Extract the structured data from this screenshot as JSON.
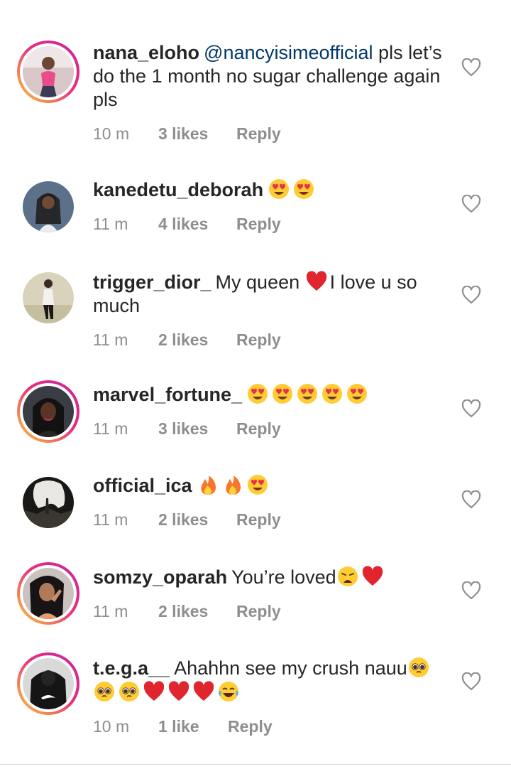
{
  "comments": [
    {
      "username": "nana_eloho",
      "mention": "@nancyisimeofficial",
      "text": " pls let’s do the 1 month no sugar challenge again pls",
      "time": "10 m",
      "likes": "3 likes",
      "reply": "Reply",
      "emojis": [],
      "emoji_text": ""
    },
    {
      "username": "kanedetu_deborah",
      "mention": "",
      "text": "",
      "time": "11 m",
      "likes": "4 likes",
      "reply": "Reply",
      "emojis": [
        "heart-eyes",
        "heart-eyes"
      ],
      "emoji_text": ""
    },
    {
      "username": "trigger_dior_",
      "mention": "",
      "text": "My queen ",
      "time": "11 m",
      "likes": "2 likes",
      "reply": "Reply",
      "emojis": [
        "red-heart"
      ],
      "emoji_text": "I love u so much"
    },
    {
      "username": "marvel_fortune_",
      "mention": "",
      "text": "",
      "time": "11 m",
      "likes": "3 likes",
      "reply": "Reply",
      "emojis": [
        "heart-eyes",
        "heart-eyes",
        "heart-eyes",
        "heart-eyes",
        "heart-eyes"
      ],
      "emoji_text": ""
    },
    {
      "username": "official_ica",
      "mention": "",
      "text": "",
      "time": "11 m",
      "likes": "2 likes",
      "reply": "Reply",
      "emojis": [
        "fire",
        "fire",
        "heart-eyes"
      ],
      "emoji_text": ""
    },
    {
      "username": "somzy_oparah",
      "mention": "",
      "text": "You’re loved",
      "time": "11 m",
      "likes": "2 likes",
      "reply": "Reply",
      "emojis": [
        "weary-face",
        "red-heart"
      ],
      "emoji_text": ""
    },
    {
      "username": "t.e.g.a__",
      "mention": "",
      "text": "Ahahhn see my crush nauu",
      "time": "10 m",
      "likes": "1 like",
      "reply": "Reply",
      "emojis": [
        "pleading-face",
        "pleading-face",
        "pleading-face",
        "red-heart",
        "red-heart",
        "red-heart",
        "tears-of-joy"
      ],
      "emoji_text": ""
    }
  ],
  "colors": {
    "text": "#262626",
    "meta": "#8e8e8e",
    "mention": "#00376b",
    "story_ring_start": "#f9ce34",
    "story_ring_end": "#c026a6"
  }
}
